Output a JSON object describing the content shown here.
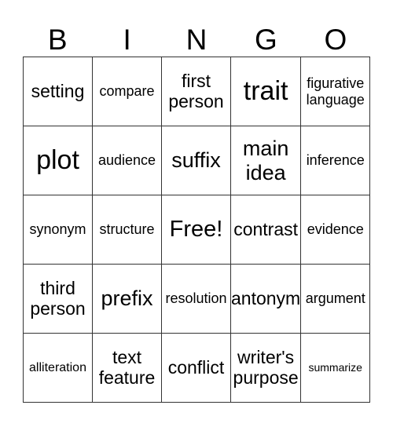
{
  "header": [
    "B",
    "I",
    "N",
    "G",
    "O"
  ],
  "rows": [
    [
      {
        "text": "setting",
        "size": "lg"
      },
      {
        "text": "compare",
        "size": "md"
      },
      {
        "text": "first person",
        "size": "lg"
      },
      {
        "text": "trait",
        "size": "xxl"
      },
      {
        "text": "figurative language",
        "size": "md"
      }
    ],
    [
      {
        "text": "plot",
        "size": "xxl"
      },
      {
        "text": "audience",
        "size": "md"
      },
      {
        "text": "suffix",
        "size": "xl"
      },
      {
        "text": "main idea",
        "size": "xl"
      },
      {
        "text": "inference",
        "size": "md"
      }
    ],
    [
      {
        "text": "synonym",
        "size": "md"
      },
      {
        "text": "structure",
        "size": "md"
      },
      {
        "text": "Free!",
        "size": "free"
      },
      {
        "text": "contrast",
        "size": "lg"
      },
      {
        "text": "evidence",
        "size": "md"
      }
    ],
    [
      {
        "text": "third person",
        "size": "lg"
      },
      {
        "text": "prefix",
        "size": "xl"
      },
      {
        "text": "resolution",
        "size": "md"
      },
      {
        "text": "antonym",
        "size": "lg"
      },
      {
        "text": "argument",
        "size": "md"
      }
    ],
    [
      {
        "text": "alliteration",
        "size": "sm"
      },
      {
        "text": "text feature",
        "size": "lg"
      },
      {
        "text": "conflict",
        "size": "lg"
      },
      {
        "text": "writer's purpose",
        "size": "lg"
      },
      {
        "text": "summarize",
        "size": "xs"
      }
    ]
  ]
}
